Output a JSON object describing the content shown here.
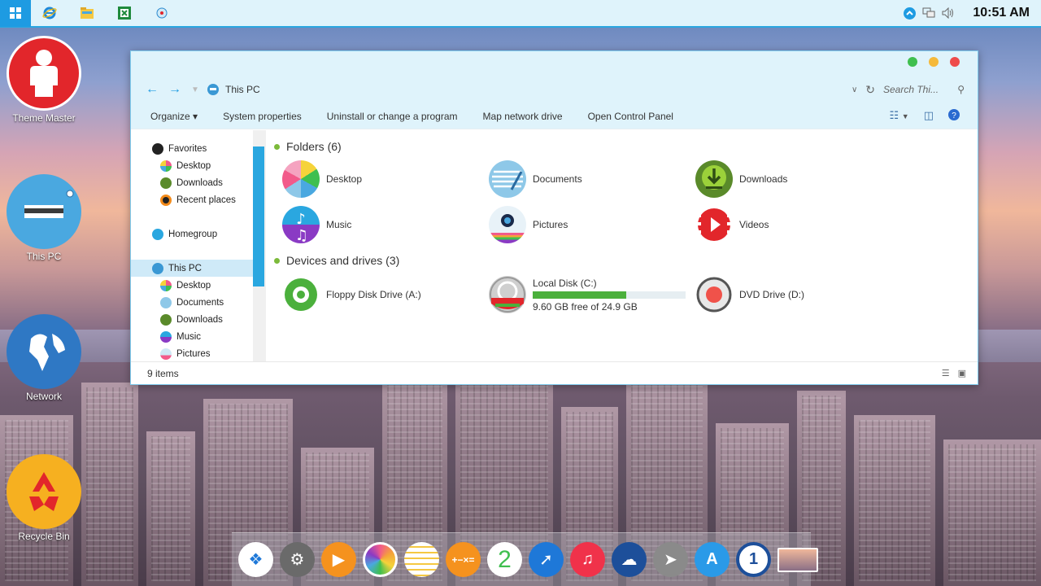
{
  "taskbar": {
    "start_icon": "windows-logo-icon",
    "pinned": [
      "internet-explorer-icon",
      "file-explorer-icon",
      "excel-icon",
      "media-icon"
    ],
    "tray_icons": [
      "chevron-up-icon",
      "network-icon",
      "volume-icon"
    ],
    "clock": "10:51 AM"
  },
  "desktop": {
    "icons": [
      {
        "label": "Theme Master",
        "icon": "user-icon",
        "color": "#e2262b"
      },
      {
        "label": "This PC",
        "icon": "computer-icon",
        "color": "#4aa8e0"
      },
      {
        "label": "Network",
        "icon": "globe-icon",
        "color": "#2f78c4"
      },
      {
        "label": "Recycle Bin",
        "icon": "recycle-icon",
        "color": "#f6b020"
      }
    ]
  },
  "window": {
    "address": {
      "crumb": "This PC",
      "search_placeholder": "Search Thi..."
    },
    "commands": [
      "Organize",
      "System properties",
      "Uninstall or change a program",
      "Map network drive",
      "Open Control Panel"
    ],
    "nav": {
      "favorites": "Favorites",
      "favorites_items": [
        "Desktop",
        "Downloads",
        "Recent places"
      ],
      "homegroup": "Homegroup",
      "this_pc": "This PC",
      "this_pc_items": [
        "Desktop",
        "Documents",
        "Downloads",
        "Music",
        "Pictures"
      ]
    },
    "folders_header": "Folders (6)",
    "folders": [
      {
        "name": "Desktop",
        "icon": "desktop-folder-icon"
      },
      {
        "name": "Documents",
        "icon": "documents-folder-icon"
      },
      {
        "name": "Downloads",
        "icon": "downloads-folder-icon"
      },
      {
        "name": "Music",
        "icon": "music-folder-icon"
      },
      {
        "name": "Pictures",
        "icon": "pictures-folder-icon"
      },
      {
        "name": "Videos",
        "icon": "videos-folder-icon"
      }
    ],
    "devices_header": "Devices and drives (3)",
    "devices": [
      {
        "name": "Floppy Disk Drive (A:)",
        "icon": "floppy-drive-icon"
      },
      {
        "name": "Local Disk (C:)",
        "icon": "hard-disk-icon",
        "free": "9.60 GB free of 24.9 GB",
        "used_fraction": 0.614
      },
      {
        "name": "DVD Drive (D:)",
        "icon": "dvd-drive-icon"
      }
    ],
    "status": "9 items"
  },
  "dock": [
    "dropbox-icon",
    "settings-icon",
    "media-player-icon",
    "photos-icon",
    "notes-icon",
    "calculator-icon",
    "calendar-icon",
    "safari-icon",
    "music-icon",
    "onedrive-icon",
    "launchpad-icon",
    "app-store-icon",
    "password-icon",
    "screenshot-icon"
  ],
  "dock_texts": {
    "calendar_number": "2"
  },
  "colors": {
    "accent": "#2aa7e0",
    "taskbar_bg": "#dff3fb",
    "progress": "#4bb03c"
  }
}
